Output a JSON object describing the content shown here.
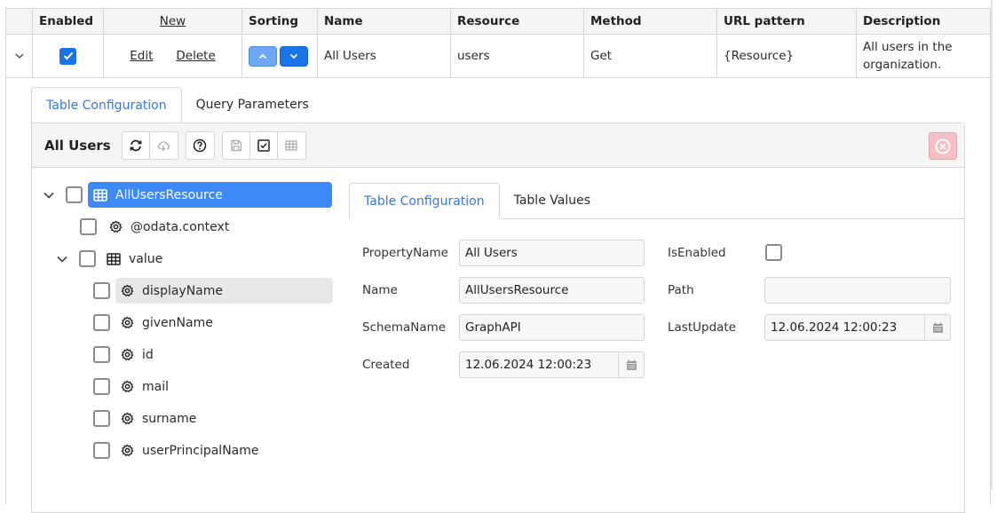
{
  "grid": {
    "headers": {
      "enabled": "Enabled",
      "new": "New",
      "sorting": "Sorting",
      "name": "Name",
      "resource": "Resource",
      "method": "Method",
      "url_pattern": "URL pattern",
      "description": "Description"
    },
    "row": {
      "enabled": true,
      "edit": "Edit",
      "delete": "Delete",
      "name": "All Users",
      "resource": "users",
      "method": "Get",
      "url_pattern": "{Resource}",
      "description": "All users in the organization."
    }
  },
  "detail": {
    "tabs": [
      "Table Configuration",
      "Query Parameters"
    ],
    "active_tab": "Table Configuration",
    "toolbar": {
      "title": "All Users",
      "buttons": [
        "refresh-icon",
        "cloud-download-icon",
        "help-icon",
        "save-icon",
        "checkbox-icon",
        "grid-icon"
      ]
    },
    "tree": [
      {
        "label": "AllUsersResource",
        "icon": "table-icon",
        "level": 0,
        "expanded": true,
        "selected": true
      },
      {
        "label": "@odata.context",
        "icon": "gear-icon",
        "level": 1
      },
      {
        "label": "value",
        "icon": "table-icon",
        "level": 1,
        "expanded": true
      },
      {
        "label": "displayName",
        "icon": "gear-icon",
        "level": 2,
        "hover": true
      },
      {
        "label": "givenName",
        "icon": "gear-icon",
        "level": 2
      },
      {
        "label": "id",
        "icon": "gear-icon",
        "level": 2
      },
      {
        "label": "mail",
        "icon": "gear-icon",
        "level": 2
      },
      {
        "label": "surname",
        "icon": "gear-icon",
        "level": 2
      },
      {
        "label": "userPrincipalName",
        "icon": "gear-icon",
        "level": 2
      }
    ],
    "form": {
      "tabs": [
        "Table Configuration",
        "Table Values"
      ],
      "active_tab": "Table Configuration",
      "fields": {
        "property_name": {
          "label": "PropertyName",
          "value": "All Users"
        },
        "name": {
          "label": "Name",
          "value": "AllUsersResource"
        },
        "schema_name": {
          "label": "SchemaName",
          "value": "GraphAPI"
        },
        "created": {
          "label": "Created",
          "value": "12.06.2024 12:00:23"
        },
        "is_enabled": {
          "label": "IsEnabled",
          "checked": false
        },
        "path": {
          "label": "Path",
          "value": ""
        },
        "last_update": {
          "label": "LastUpdate",
          "value": "12.06.2024 12:00:23"
        }
      }
    }
  },
  "colors": {
    "accent": "#1a73e8",
    "selected_node": "#3d8af7",
    "active_tab_text": "#3a76e0",
    "close_button": "#f5c0c5"
  }
}
